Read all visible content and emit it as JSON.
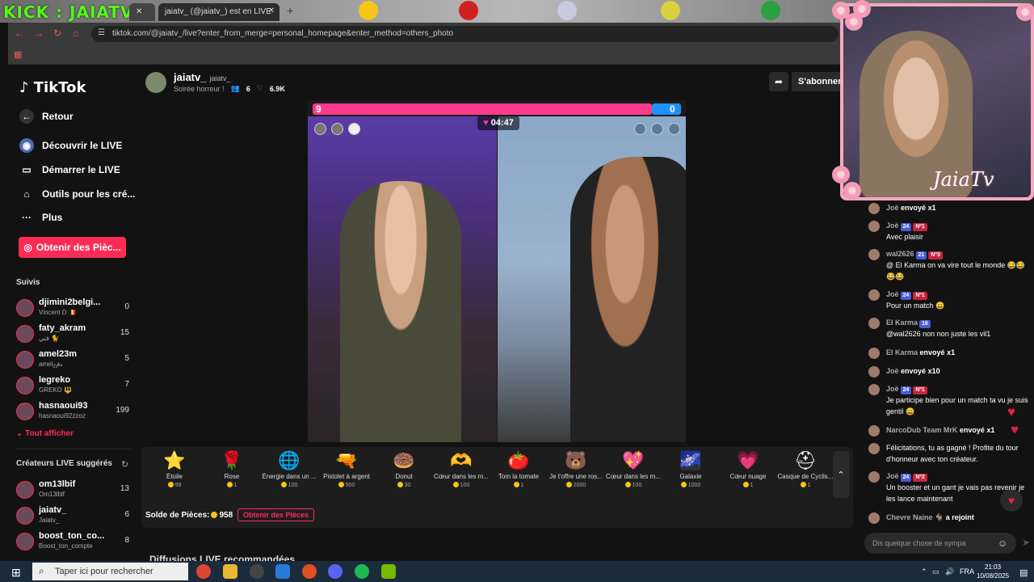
{
  "browser": {
    "kick_banner": "KICK : JAIATV",
    "tab_title": "jaiatv_ (@jaiatv_) est en LIVE",
    "url": "tiktok.com/@jaiatv_/live?enter_from_merge=personal_homepage&enter_method=others_photo"
  },
  "sidebar": {
    "logo": "TikTok",
    "back": "Retour",
    "nav": [
      {
        "label": "Découvrir le LIVE",
        "icon": "live-globe-icon"
      },
      {
        "label": "Démarrer le LIVE",
        "icon": "camera-icon"
      },
      {
        "label": "Outils pour les cré...",
        "icon": "house-icon"
      },
      {
        "label": "Plus",
        "icon": "dots-icon"
      }
    ],
    "coins_button": "Obtenir des Pièc...",
    "followed_title": "Suivis",
    "followed": [
      {
        "name": "djimini2belgi...",
        "sub": "Vincent D 🇧🇪",
        "count": "0"
      },
      {
        "name": "faty_akram",
        "sub": "فتي 🐈",
        "count": "15"
      },
      {
        "name": "amel23m",
        "sub": "amel𝓏𝓅𝓈",
        "count": "5"
      },
      {
        "name": "legreko",
        "sub": "GREKO 🔱",
        "count": "7"
      },
      {
        "name": "hasnaoui93",
        "sub": "hasnaoui92ᴢᴢᴏᴢ",
        "count": "199"
      }
    ],
    "show_all": "Tout afficher",
    "suggested_title": "Créateurs LIVE suggérés",
    "suggested": [
      {
        "name": "om13lbif",
        "sub": "Om13lblf",
        "count": "13"
      },
      {
        "name": "jaiatv_",
        "sub": "Jaiatv_",
        "count": "6"
      },
      {
        "name": "boost_ton_co...",
        "sub": "Boost_ton_compte",
        "count": "8"
      }
    ]
  },
  "header": {
    "name": "jaiatv_",
    "handle": "jaiatv_",
    "title": "Soirée horreur !",
    "viewers": "6",
    "likes": "6.9K",
    "subscribe": "S'abonner"
  },
  "pk": {
    "left_score": "9",
    "right_score": "0",
    "left_fraction": 0.92,
    "timer": "04:47"
  },
  "gifts": [
    {
      "name": "Étoile",
      "price": "99",
      "icon": "⭐"
    },
    {
      "name": "Rose",
      "price": "1",
      "icon": "🌹"
    },
    {
      "name": "Énergie dans un ...",
      "price": "100",
      "icon": "🌐"
    },
    {
      "name": "Pistolet à argent",
      "price": "500",
      "icon": "🔫"
    },
    {
      "name": "Donut",
      "price": "30",
      "icon": "🍩"
    },
    {
      "name": "Cœur dans les m...",
      "price": "100",
      "icon": "🫶"
    },
    {
      "name": "Tom la tomate",
      "price": "1",
      "icon": "🍅"
    },
    {
      "name": "Je t'offre une ros...",
      "price": "2000",
      "icon": "🐻"
    },
    {
      "name": "Cœur dans les m...",
      "price": "100",
      "icon": "💖"
    },
    {
      "name": "Galaxie",
      "price": "1000",
      "icon": "🌌"
    },
    {
      "name": "Cœur nuage",
      "price": "1",
      "icon": "💗"
    },
    {
      "name": "Casque de Cyclis...",
      "price": "1",
      "icon": "⛑"
    }
  ],
  "balance": {
    "label": "Solde de Pièces:",
    "value": "958",
    "button": "Obtenir des Pièces"
  },
  "recommended": "Diffusions LIVE recommandées",
  "overlay_name": "JaiaTv",
  "chat": {
    "messages": [
      {
        "user": "Joë",
        "lvl": "",
        "rank": "",
        "text": "",
        "action": "envoyé",
        "qty": "x1"
      },
      {
        "user": "Joë",
        "lvl": "24",
        "rank": "Nº1",
        "text": "Avec plaisir",
        "action": "",
        "qty": ""
      },
      {
        "user": "wal2626",
        "lvl": "21",
        "rank": "Nº3",
        "text": "@ El Karma on va vire tout le monde 😂😂😂😂",
        "action": "",
        "qty": ""
      },
      {
        "user": "Joë",
        "lvl": "24",
        "rank": "Nº1",
        "text": "Pour un match 😄",
        "action": "",
        "qty": ""
      },
      {
        "user": "El Karma",
        "lvl": "16",
        "rank": "",
        "text": "@wal2626 non non juste les vil1",
        "action": "",
        "qty": ""
      },
      {
        "user": "El Karma",
        "lvl": "",
        "rank": "",
        "text": "",
        "action": "envoyé",
        "qty": "x1"
      },
      {
        "user": "Joë",
        "lvl": "",
        "rank": "",
        "text": "",
        "action": "envoyé",
        "qty": "x10"
      },
      {
        "user": "Joë",
        "lvl": "24",
        "rank": "Nº1",
        "text": "Je participe bien pour un match ta vu je suis gentil 😄",
        "action": "",
        "qty": ""
      },
      {
        "user": "NarcoDub Team MrK",
        "lvl": "",
        "rank": "",
        "text": "",
        "action": "envoyé",
        "qty": "x1"
      },
      {
        "user": "",
        "lvl": "",
        "rank": "",
        "text": "Félicitations, tu as gagné ! Profite du tour d'honneur avec ton créateur.",
        "action": "",
        "qty": ""
      },
      {
        "user": "Joë",
        "lvl": "24",
        "rank": "Nº2",
        "text": "Un booster et un gant je vais pas revenir je les lance maintenant",
        "action": "",
        "qty": ""
      },
      {
        "user": "Chevre Naine 🐐",
        "lvl": "",
        "rank": "",
        "text": "",
        "action": "a rejoint",
        "qty": ""
      }
    ],
    "input_placeholder": "Dis quelque chose de sympa"
  },
  "taskbar": {
    "search_placeholder": "Taper ici pour rechercher",
    "lang": "FRA",
    "time": "21:03",
    "date": "10/08/2025"
  },
  "colors": {
    "accent": "#fe2c55",
    "pk_pink": "#ff3b8b",
    "pk_blue": "#1e90ff",
    "kick_green": "#53fc18"
  }
}
